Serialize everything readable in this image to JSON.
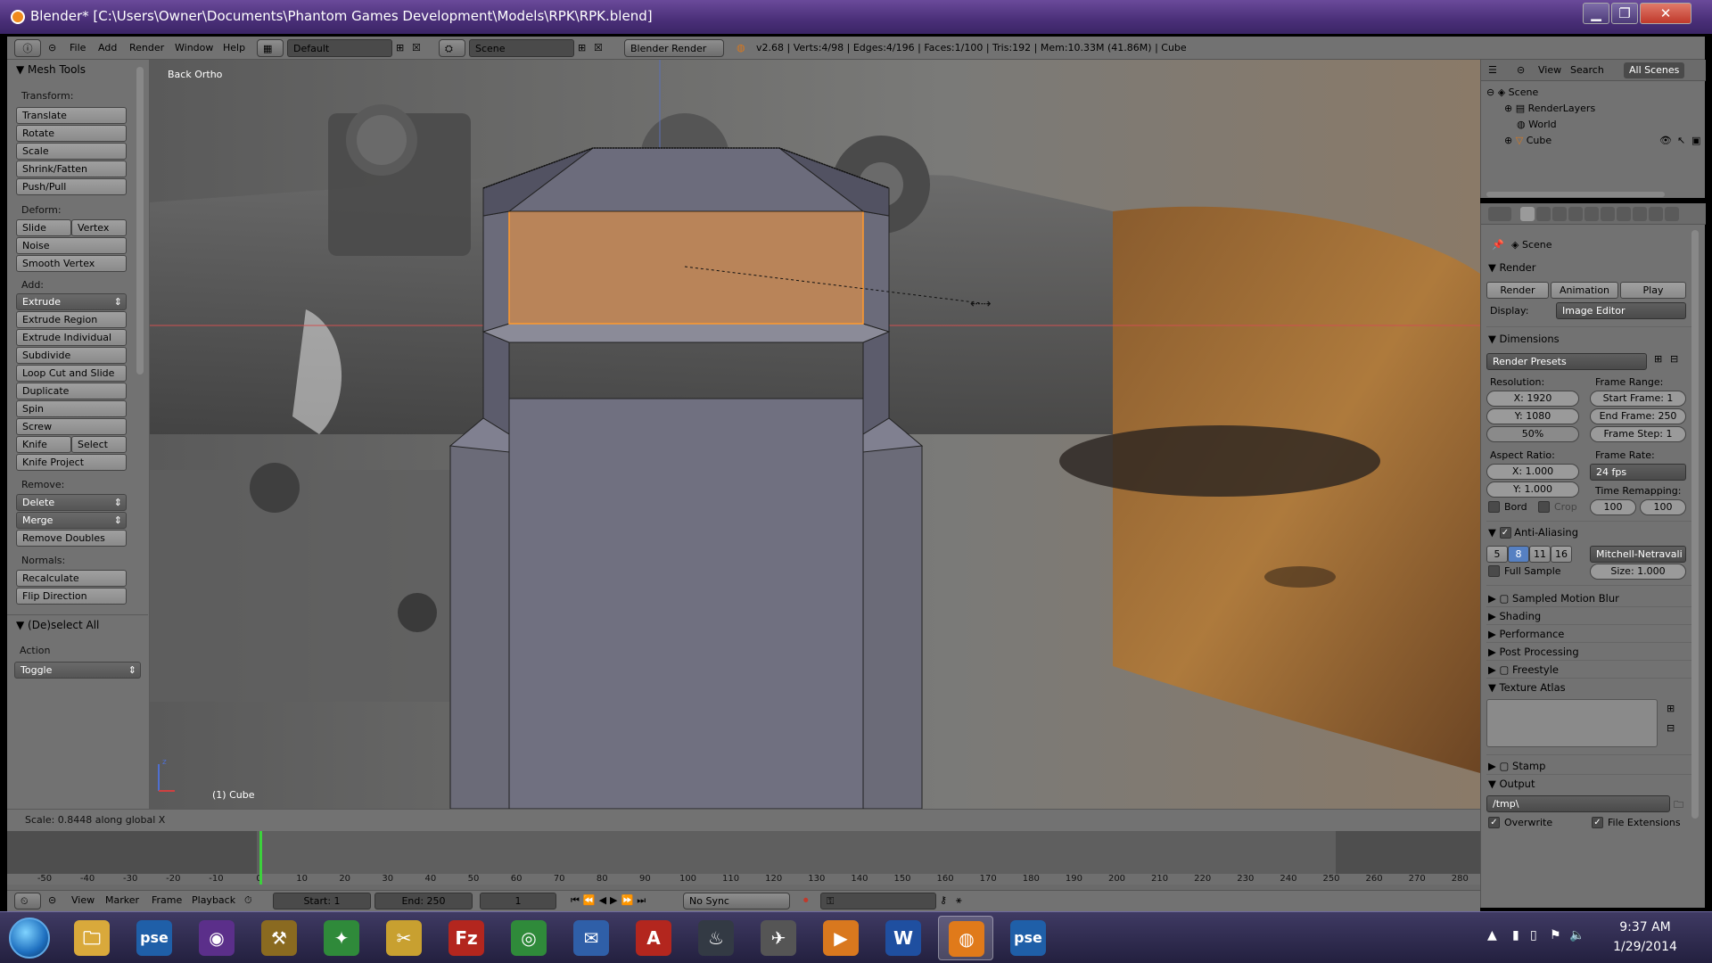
{
  "window": {
    "title": "Blender* [C:\\Users\\Owner\\Documents\\Phantom Games Development\\Models\\RPK\\RPK.blend]",
    "min_glyph": "▁",
    "max_glyph": "❐",
    "close_glyph": "✕"
  },
  "header": {
    "menus": [
      "File",
      "Add",
      "Render",
      "Window",
      "Help"
    ],
    "screen_layout": "Default",
    "scene": "Scene",
    "engine": "Blender Render",
    "stats": "v2.68 | Verts:4/98 | Edges:4/196 | Faces:1/100 | Tris:192 | Mem:10.33M (41.86M) | Cube"
  },
  "toolshelf": {
    "title": "Mesh Tools",
    "sections": {
      "transform": "Transform:",
      "deform": "Deform:",
      "add": "Add:",
      "remove": "Remove:",
      "normals": "Normals:"
    },
    "transform": [
      "Translate",
      "Rotate",
      "Scale",
      "Shrink/Fatten",
      "Push/Pull"
    ],
    "deform": [
      "Slide Edge",
      "Vertex",
      "Noise",
      "Smooth Vertex"
    ],
    "add": [
      "Extrude",
      "Extrude Region",
      "Extrude Individual",
      "Subdivide",
      "Loop Cut and Slide",
      "Duplicate",
      "Spin",
      "Screw",
      "Knife",
      "Select",
      "Knife Project"
    ],
    "remove": [
      "Delete",
      "Merge",
      "Remove Doubles"
    ],
    "normals": [
      "Recalculate",
      "Flip Direction"
    ],
    "operator_panel": "(De)select All",
    "action_label": "Action",
    "action_value": "Toggle"
  },
  "viewport": {
    "view_name": "Back Ortho",
    "object_label": "(1) Cube",
    "status": "Scale: 0.8448 along global X",
    "accent_selection": "#ff9a2e",
    "selected_face_color": "#b98459"
  },
  "timeline": {
    "ticks": [
      "-50",
      "-40",
      "-30",
      "-20",
      "-10",
      "0",
      "10",
      "20",
      "30",
      "40",
      "50",
      "60",
      "70",
      "80",
      "90",
      "100",
      "110",
      "120",
      "130",
      "140",
      "150",
      "160",
      "170",
      "180",
      "190",
      "200",
      "210",
      "220",
      "230",
      "240",
      "250",
      "260",
      "270",
      "280"
    ],
    "menus": [
      "View",
      "Marker",
      "Frame",
      "Playback"
    ],
    "start": "Start: 1",
    "end": "End: 250",
    "current": "1",
    "sync": "No Sync",
    "current_frame_color": "#3cd23c"
  },
  "outliner": {
    "menus": [
      "View",
      "Search"
    ],
    "filter": "All Scenes",
    "items": [
      "Scene",
      "RenderLayers",
      "World",
      "Cube"
    ]
  },
  "properties": {
    "context": "Scene",
    "render_header": "Render",
    "render_btn": "Render",
    "animation_btn": "Animation",
    "play_btn": "Play",
    "display_label": "Display:",
    "display_value": "Image Editor",
    "dimensions_header": "Dimensions",
    "render_presets": "Render Presets",
    "resolution_label": "Resolution:",
    "res_x": "X: 1920",
    "res_y": "Y: 1080",
    "res_pct": "50%",
    "frame_range_label": "Frame Range:",
    "start_frame": "Start Frame: 1",
    "end_frame": "End Frame: 250",
    "frame_step": "Frame Step: 1",
    "aspect_label": "Aspect Ratio:",
    "aspect_x": "X: 1.000",
    "aspect_y": "Y: 1.000",
    "frame_rate_label": "Frame Rate:",
    "frame_rate": "24 fps",
    "time_remap_label": "Time Remapping:",
    "remap_old": "100",
    "remap_new": "100",
    "bord": "Bord",
    "crop": "Crop",
    "aa_header": "Anti-Aliasing",
    "aa_samples": [
      "5",
      "8",
      "11",
      "16"
    ],
    "aa_filter": "Mitchell-Netravali",
    "full_sample": "Full Sample",
    "aa_size": "Size: 1.000",
    "collapsed": [
      "Sampled Motion Blur",
      "Shading",
      "Performance",
      "Post Processing",
      "Freestyle"
    ],
    "texture_atlas": "Texture Atlas",
    "stamp": "Stamp",
    "output_header": "Output",
    "output_path": "/tmp\\",
    "overwrite": "Overwrite",
    "file_extensions": "File Extensions",
    "active_sample_color": "#5680c2"
  },
  "taskbar": {
    "time": "9:37 AM",
    "date": "1/29/2014",
    "apps": [
      {
        "name": "explorer-icon",
        "glyph": "🗀",
        "color": "#d9a93b"
      },
      {
        "name": "pse-icon",
        "glyph": "pse",
        "color": "#1f5fa8"
      },
      {
        "name": "app-purple-icon",
        "glyph": "◉",
        "color": "#5b2f8a"
      },
      {
        "name": "app-tool-icon",
        "glyph": "⚒",
        "color": "#8a6a20"
      },
      {
        "name": "app-green-icon",
        "glyph": "✦",
        "color": "#2f8a3a"
      },
      {
        "name": "app-snip-icon",
        "glyph": "✂",
        "color": "#c8a030"
      },
      {
        "name": "filezilla-icon",
        "glyph": "Fz",
        "color": "#b3261e"
      },
      {
        "name": "chrome-icon",
        "glyph": "◎",
        "color": "#2f8a3a"
      },
      {
        "name": "thunderbird-icon",
        "glyph": "✉",
        "color": "#2f5fa8"
      },
      {
        "name": "acrobat-icon",
        "glyph": "A",
        "color": "#b3261e"
      },
      {
        "name": "steam-icon",
        "glyph": "♨",
        "color": "#333a44"
      },
      {
        "name": "app-plane-icon",
        "glyph": "✈",
        "color": "#555"
      },
      {
        "name": "media-icon",
        "glyph": "▶",
        "color": "#d9781e"
      },
      {
        "name": "word-icon",
        "glyph": "W",
        "color": "#1f4fa0"
      },
      {
        "name": "blender-icon",
        "glyph": "◍",
        "color": "#e07a1a"
      },
      {
        "name": "pse2-icon",
        "glyph": "pse",
        "color": "#1f5fa8"
      }
    ]
  }
}
